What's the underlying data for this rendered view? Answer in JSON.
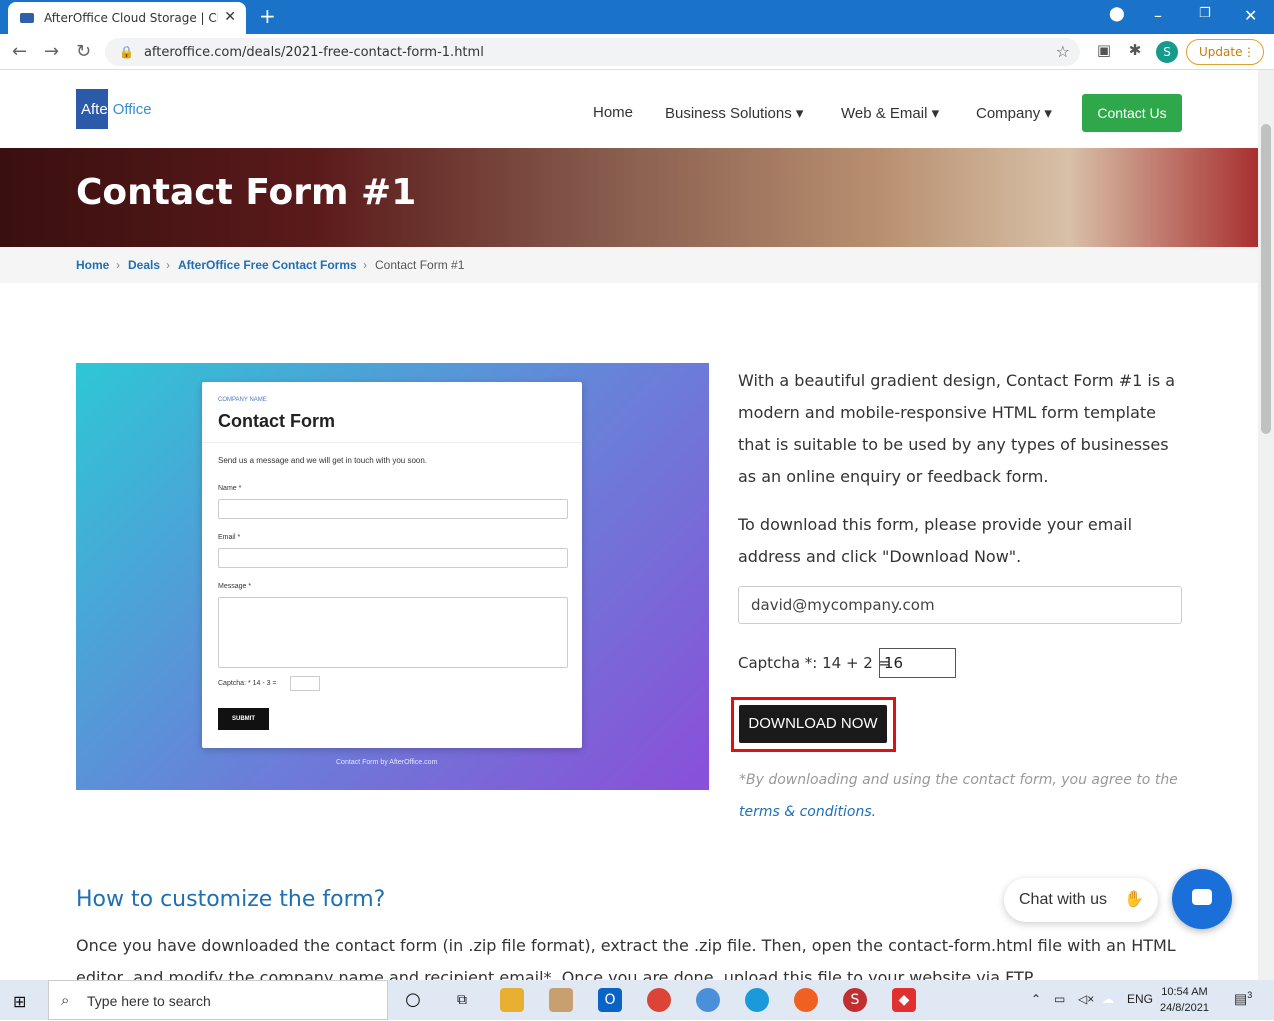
{
  "browser": {
    "tab_title": "AfterOffice Cloud Storage | Clouc",
    "url": "afteroffice.com/deals/2021-free-contact-form-1.html",
    "profile_initial": "S",
    "update_label": "Update"
  },
  "site": {
    "logo_text_a": "After",
    "logo_text_b": "Office",
    "nav": [
      "Home",
      "Business Solutions",
      "Web & Email",
      "Company"
    ],
    "contact_button": "Contact Us"
  },
  "hero": {
    "title": "Contact Form #1"
  },
  "breadcrumb": [
    "Home",
    "Deals",
    "AfterOffice Free Contact Forms",
    "Contact Form #1"
  ],
  "preview": {
    "company_name": "COMPANY NAME",
    "form_title": "Contact Form",
    "subtitle": "Send us a message and we will get in touch with you soon.",
    "name_label": "Name *",
    "email_label": "Email *",
    "message_label": "Message *",
    "captcha_label": "Captcha: * 14 - 3 =",
    "submit_label": "SUBMIT",
    "footer": "Contact Form by AfterOffice.com"
  },
  "main": {
    "description": "With a beautiful gradient design, Contact Form #1 is a modern and mobile-responsive HTML form template that is suitable to be used by any types of businesses as an online enquiry or feedback form.",
    "instruction": "To download this form, please provide your email address and click \"Download Now\".",
    "email_value": "david@mycompany.com",
    "captcha_label": "Captcha *: 14 + 2 =",
    "captcha_value": "16",
    "download_button": "DOWNLOAD NOW",
    "terms_note": "*By downloading and using the contact form, you agree to the",
    "terms_link": "terms & conditions.",
    "section_heading": "How to customize the form?",
    "section_text": "Once you have downloaded the contact form (in .zip file format), extract the .zip file. Then, open the contact-form.html file with an HTML editor, and modify the company name and recipient email*. Once you are done, upload this file to your website via FTP."
  },
  "chat": {
    "label": "Chat with us"
  },
  "taskbar": {
    "search_placeholder": "Type here to search",
    "language": "ENG",
    "time": "10:54 AM",
    "date": "24/8/2021",
    "notifications": "3"
  }
}
